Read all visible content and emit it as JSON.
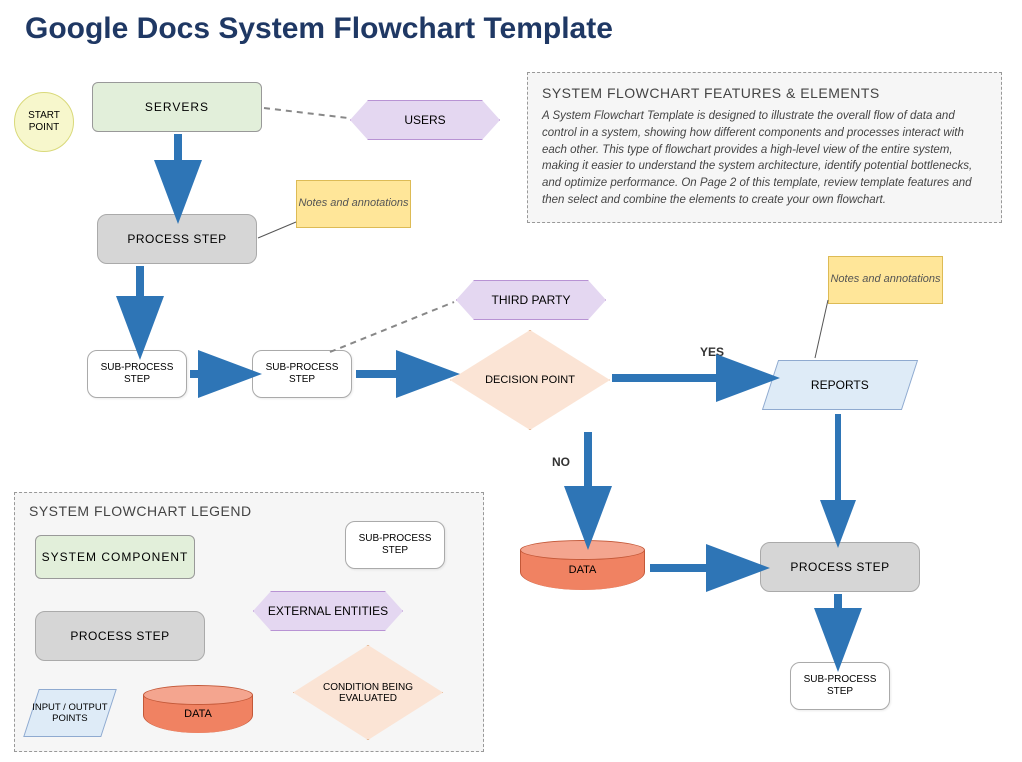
{
  "title": "Google Docs System Flowchart Template",
  "info": {
    "title": "SYSTEM FLOWCHART FEATURES & ELEMENTS",
    "body": "A System Flowchart Template is designed to illustrate the overall flow of data and control in a system, showing how different components and processes interact with each other. This type of flowchart provides a high-level view of the entire system, making it easier to understand the system architecture, identify potential bottlenecks, and optimize performance. On Page 2 of this template, review template features and then select and combine the elements to create your own flowchart."
  },
  "flow": {
    "start": "START POINT",
    "servers": "SERVERS",
    "users": "USERS",
    "note1": "Notes and annotations",
    "process": "PROCESS STEP",
    "sub1": "SUB-PROCESS STEP",
    "sub2": "SUB-PROCESS STEP",
    "thirdparty": "THIRD PARTY",
    "decision": "DECISION POINT",
    "yes": "YES",
    "no": "NO",
    "reports": "REPORTS",
    "note2": "Notes and annotations",
    "data": "DATA",
    "process2": "PROCESS STEP",
    "sub3": "SUB-PROCESS STEP"
  },
  "legend": {
    "title": "SYSTEM FLOWCHART LEGEND",
    "syscomp": "SYSTEM COMPONENT",
    "subp": "SUB-PROCESS STEP",
    "ext": "EXTERNAL ENTITIES",
    "proc": "PROCESS STEP",
    "cond": "CONDITION BEING EVALUATED",
    "io": "INPUT / OUTPUT POINTS",
    "data": "DATA"
  }
}
